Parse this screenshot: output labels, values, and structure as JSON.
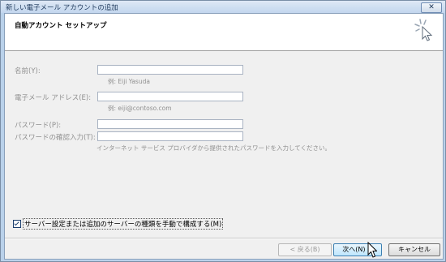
{
  "window": {
    "title": "新しい電子メール アカウントの追加",
    "close_glyph": "✕"
  },
  "header": {
    "title": "自動アカウント セットアップ"
  },
  "form": {
    "name_label": "名前(Y):",
    "name_value": "",
    "name_hint": "例: Eiji Yasuda",
    "email_label": "電子メール アドレス(E):",
    "email_value": "",
    "email_hint": "例: eiji@contoso.com",
    "password_label": "パスワード(P):",
    "password_value": "",
    "password_confirm_label": "パスワードの確認入力(T):",
    "password_confirm_value": "",
    "password_hint": "インターネット サービス プロバイダから提供されたパスワードを入力してください。"
  },
  "manual_setup": {
    "label": "サーバー設定または追加のサーバーの種類を手動で構成する(M)",
    "checked": true
  },
  "buttons": {
    "back": "< 戻る(B)",
    "next": "次へ(N) >",
    "cancel": "キャンセル"
  },
  "icons": {
    "wizard": "wizard-sparkle-cursor-icon",
    "cursor": "mouse-pointer-icon",
    "close": "close-icon"
  }
}
